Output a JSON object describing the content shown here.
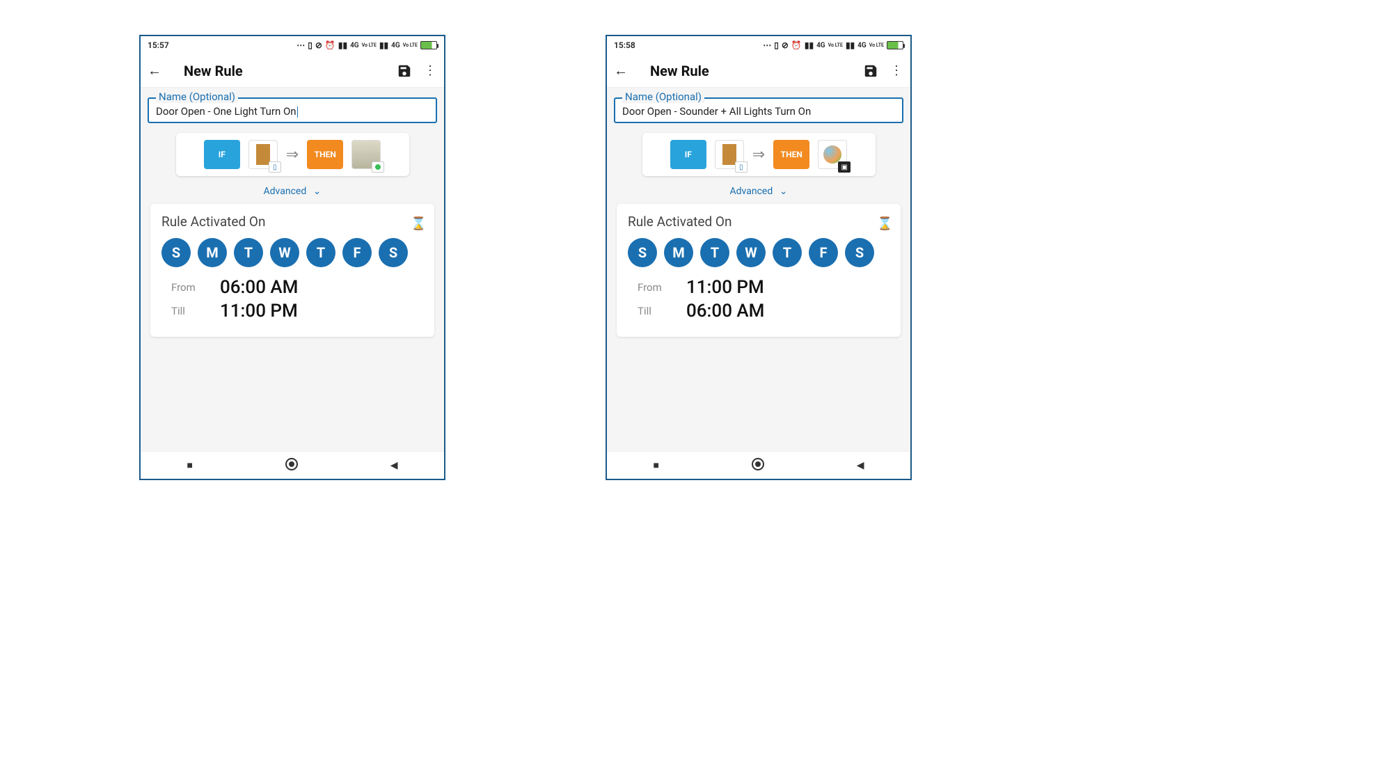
{
  "screens": [
    {
      "status": {
        "time": "15:57",
        "net1": "4G",
        "lte1": "Vo LTE",
        "net2": "4G",
        "lte2": "Vo LTE"
      },
      "header": {
        "title": "New Rule"
      },
      "name": {
        "legend": "Name (Optional)",
        "value": "Door Open - One Light Turn On",
        "cursor": true
      },
      "ifthen": {
        "if_label": "IF",
        "then_label": "THEN"
      },
      "advanced_label": "Advanced",
      "activated": {
        "title": "Rule Activated On",
        "days": [
          "S",
          "M",
          "T",
          "W",
          "T",
          "F",
          "S"
        ],
        "from_label": "From",
        "from_value": "06:00 AM",
        "till_label": "Till",
        "till_value": "11:00 PM"
      }
    },
    {
      "status": {
        "time": "15:58",
        "net1": "4G",
        "lte1": "Vo LTE",
        "net2": "4G",
        "lte2": "Vo LTE"
      },
      "header": {
        "title": "New Rule"
      },
      "name": {
        "legend": "Name (Optional)",
        "value": "Door Open - Sounder + All Lights Turn On",
        "cursor": false
      },
      "ifthen": {
        "if_label": "IF",
        "then_label": "THEN"
      },
      "advanced_label": "Advanced",
      "activated": {
        "title": "Rule Activated On",
        "days": [
          "S",
          "M",
          "T",
          "W",
          "T",
          "F",
          "S"
        ],
        "from_label": "From",
        "from_value": "11:00 PM",
        "till_label": "Till",
        "till_value": "06:00 AM"
      }
    }
  ]
}
